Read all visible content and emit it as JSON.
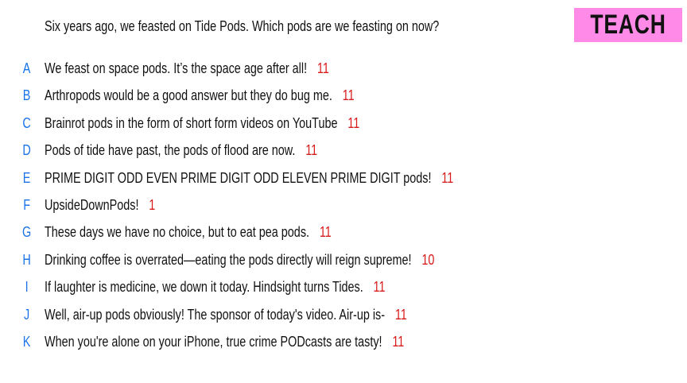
{
  "question": "Six years ago, we feasted on Tide Pods. Which pods are we feasting on now?",
  "badge": "TEACH",
  "answers": [
    {
      "letter": "A",
      "text": "We feast on space pods. It’s the space age after all!",
      "count": "11"
    },
    {
      "letter": "B",
      "text": "Arthropods would be a good answer but they do bug me.",
      "count": "11"
    },
    {
      "letter": "C",
      "text": "Brainrot pods in the form of short form videos on YouTube",
      "count": "11"
    },
    {
      "letter": "D",
      "text": "Pods of tide have past, the pods of flood are now.",
      "count": "11"
    },
    {
      "letter": "E",
      "text": "PRIME DIGIT ODD EVEN PRIME DIGIT ODD ELEVEN PRIME DIGIT pods!",
      "count": "11"
    },
    {
      "letter": "F",
      "text": "UpsideDownPods!",
      "count": "1"
    },
    {
      "letter": "G",
      "text": "These days we have no choice, but to eat pea pods.",
      "count": "11"
    },
    {
      "letter": "H",
      "text": "Drinking coffee is overrated—eating the pods directly will reign supreme!",
      "count": "10"
    },
    {
      "letter": "I",
      "text": "If laughter is medicine, we down it today. Hindsight turns Tides.",
      "count": "11"
    },
    {
      "letter": "J",
      "text": "Well, air-up pods obviously! The sponsor of today's video. Air-up is-",
      "count": "11"
    },
    {
      "letter": "K",
      "text": "When you're alone on your iPhone, true crime PODcasts are tasty!",
      "count": "11"
    }
  ]
}
